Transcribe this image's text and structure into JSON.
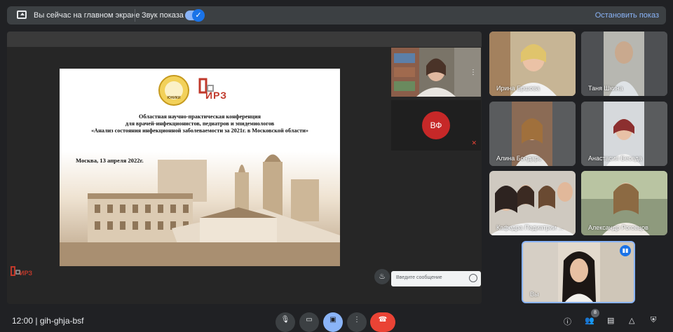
{
  "top_bar": {
    "presenting_label": "Вы сейчас на главном экране",
    "sound_label": "Звук показа",
    "sound_enabled": true,
    "stop_label": "Остановить показ"
  },
  "slide": {
    "logo_seal_text": "ЮНИКИ",
    "logo_brand": "ИРЗ",
    "title_lines": [
      "Областная научно-практическая конференция",
      "для врачей-инфекционистов, педиатров и эпидемиологов",
      "«Анализ состояния инфекционной заболеваемости за 2021г. в Московской области»"
    ],
    "date": "Москва, 13 апреля 2022г."
  },
  "bottom_logo": "ИРЗ",
  "side_tiles": {
    "vf_initials": "ВФ"
  },
  "chat": {
    "placeholder": "Введите сообщение"
  },
  "participants": [
    {
      "name": "Ирина Ершова"
    },
    {
      "name": "Таня Шкина"
    },
    {
      "name": "Алина Бондарь"
    },
    {
      "name": "Анастасия Беседа"
    },
    {
      "name": "Кафедра Педиатрии ..."
    },
    {
      "name": "Александр Роговцов"
    }
  ],
  "self_tile": {
    "name": "Вы"
  },
  "bottom_bar": {
    "clock_meeting": "12:00 | gih-ghja-bsf",
    "participants_count": "8"
  },
  "colors": {
    "accent": "#8ab4f8",
    "end_call": "#ea4335",
    "brand_red": "#c0392b"
  }
}
